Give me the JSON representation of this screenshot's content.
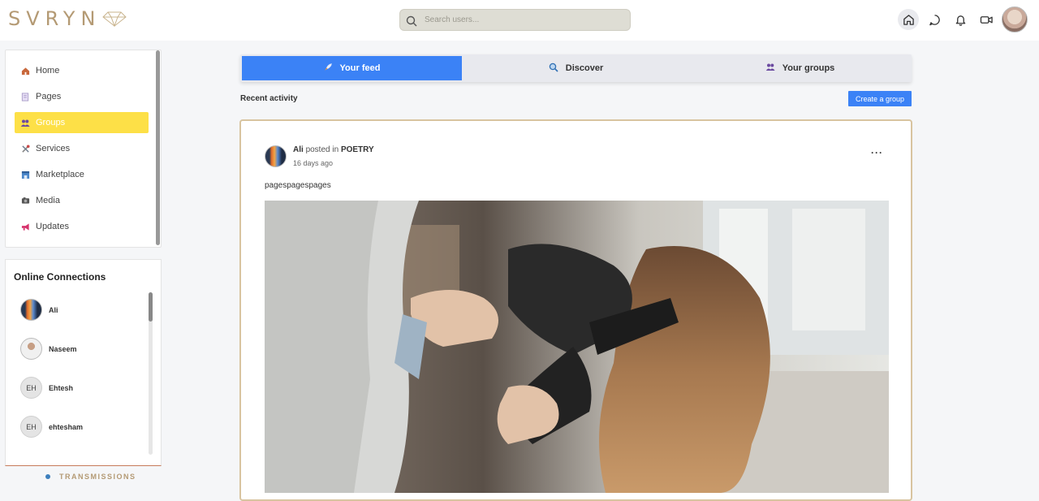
{
  "app": {
    "logo_text": "SVRYN"
  },
  "search": {
    "placeholder": "Search users..."
  },
  "top_icons": [
    "home-icon",
    "chat-icon",
    "bell-icon",
    "video-icon"
  ],
  "sidebar": {
    "items": [
      {
        "label": "Home",
        "icon": "home-icon",
        "active": false
      },
      {
        "label": "Pages",
        "icon": "pages-icon",
        "active": false
      },
      {
        "label": "Groups",
        "icon": "groups-icon",
        "active": true
      },
      {
        "label": "Services",
        "icon": "services-icon",
        "active": false
      },
      {
        "label": "Marketplace",
        "icon": "marketplace-icon",
        "active": false
      },
      {
        "label": "Media",
        "icon": "media-icon",
        "active": false
      },
      {
        "label": "Updates",
        "icon": "updates-icon",
        "active": false
      }
    ]
  },
  "connections": {
    "title": "Online Connections",
    "items": [
      {
        "name": "Ali",
        "initials": ""
      },
      {
        "name": "Naseem",
        "initials": ""
      },
      {
        "name": "Ehtesh",
        "initials": "EH"
      },
      {
        "name": "ehtesham",
        "initials": "EH"
      }
    ]
  },
  "transmissions": {
    "label": "TRANSMISSIONS"
  },
  "tabs": [
    {
      "label": "Your feed",
      "icon": "rocket-icon",
      "active": true
    },
    {
      "label": "Discover",
      "icon": "magnifier-icon",
      "active": false
    },
    {
      "label": "Your groups",
      "icon": "people-icon",
      "active": false
    }
  ],
  "feed": {
    "section_title": "Recent activity",
    "create_button": "Create a group"
  },
  "post": {
    "author": "Ali",
    "posted_in": "posted in",
    "group": "POETRY",
    "time": "16 days ago",
    "menu": "···",
    "text": "pagespagespages",
    "image": "hair-dryer-photo"
  },
  "colors": {
    "accent": "#3b82f6",
    "highlight": "#fde047",
    "brand": "#b49a74",
    "post_border": "#d8c4a0"
  }
}
